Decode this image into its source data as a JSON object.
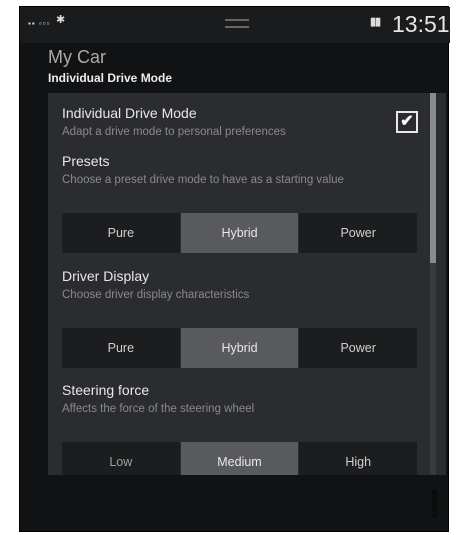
{
  "status_bar": {
    "signal_icon": "signal-icon",
    "bluetooth_icon": "bluetooth-icon",
    "pause_icon": "pause-icon",
    "time": "13:51"
  },
  "header": {
    "title": "My Car",
    "subtitle": "Individual Drive Mode"
  },
  "settings": {
    "individual_drive_mode": {
      "title": "Individual Drive Mode",
      "description": "Adapt a drive mode to personal preferences",
      "checked": true,
      "check_glyph": "✔"
    },
    "presets": {
      "title": "Presets",
      "description": "Choose a preset drive mode to have as a starting value",
      "options": [
        "Pure",
        "Hybrid",
        "Power"
      ],
      "selected": "Hybrid"
    },
    "driver_display": {
      "title": "Driver Display",
      "description": "Choose driver display characteristics",
      "options": [
        "Pure",
        "Hybrid",
        "Power"
      ],
      "selected": "Hybrid"
    },
    "steering_force": {
      "title": "Steering force",
      "description": "Affects the force of the steering wheel",
      "options": [
        "Low",
        "Medium",
        "High"
      ],
      "selected": "Medium"
    }
  },
  "image_code": "G063300"
}
